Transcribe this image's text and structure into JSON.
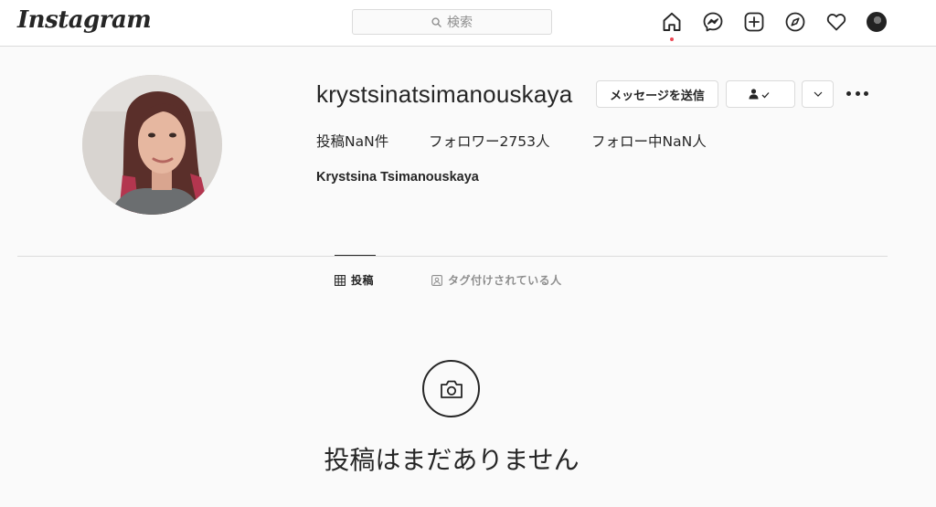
{
  "nav": {
    "logo": "Instagram",
    "search_placeholder": "検索",
    "icons": [
      "home-icon",
      "messenger-icon",
      "new-post-icon",
      "explore-icon",
      "activity-icon",
      "profile-avatar"
    ],
    "active_indicator_color": "#ed4956"
  },
  "profile": {
    "username": "krystsinatsimanouskaya",
    "message_button": "メッセージを送信",
    "follow_button_icon": "person-check-icon",
    "suggest_button_icon": "chevron-down-icon",
    "options_icon": "more-options-icon",
    "stats": {
      "posts": "投稿NaN件",
      "followers": "フォロワー2753人",
      "following": "フォロー中NaN人"
    },
    "full_name": "Krystsina Tsimanouskaya"
  },
  "tabs": [
    {
      "label": "投稿",
      "icon": "grid-icon",
      "active": true
    },
    {
      "label": "タグ付けされている人",
      "icon": "tagged-icon",
      "active": false
    }
  ],
  "empty_state": {
    "icon": "camera-icon",
    "text": "投稿はまだありません"
  },
  "colors": {
    "text": "#262626",
    "muted": "#8e8e8e",
    "border": "#dbdbdb",
    "background": "#fafafa"
  }
}
